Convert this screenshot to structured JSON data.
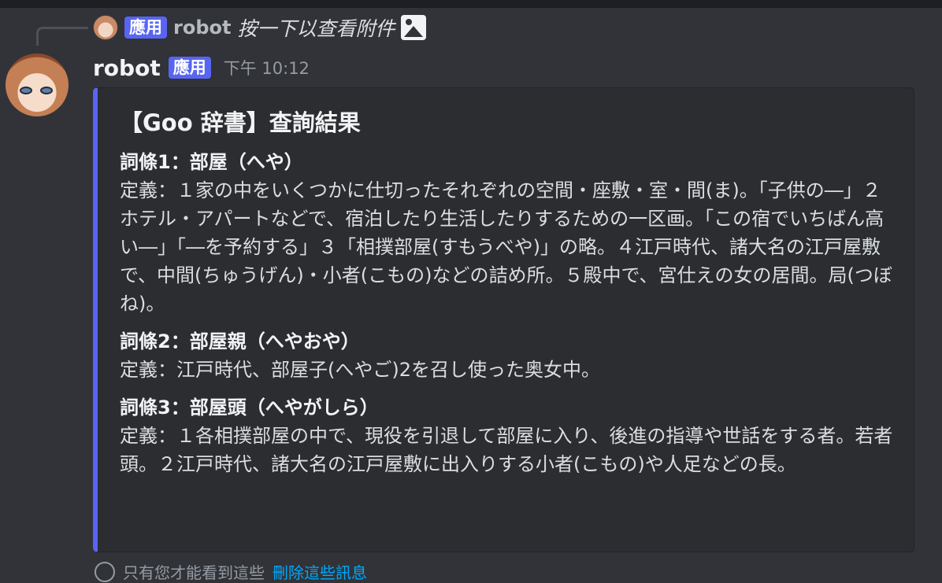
{
  "reply": {
    "app_tag": "應用",
    "author": "robot",
    "text": "按一下以查看附件",
    "attachment_icon": "image-icon"
  },
  "message": {
    "author": "robot",
    "app_tag": "應用",
    "timestamp": "下午 10:12"
  },
  "embed": {
    "accent_color": "#5865f2",
    "title": "【Goo 辞書】查詢結果",
    "entries": [
      {
        "heading": "詞條1：部屋（へや）",
        "definition": "定義：１家の中をいくつかに仕切ったそれぞれの空間・座敷・室・間(ま)。「子供の―」２ホテル・アパートなどで、宿泊したり生活したりするための一区画。「この宿でいちばん高い―」「―を予約する」３「相撲部屋(すもうべや)」の略。４江戸時代、諸大名の江戸屋敷で、中間(ちゅうげん)・小者(こもの)などの詰め所。５殿中で、宮仕えの女の居間。局(つぼね)。"
      },
      {
        "heading": "詞條2：部屋親（へやおや）",
        "definition": "定義：江戸時代、部屋子(へやご)2を召し使った奥女中。"
      },
      {
        "heading": "詞條3：部屋頭（へやがしら）",
        "definition": "定義：１各相撲部屋の中で、現役を引退して部屋に入り、後進の指導や世話をする者。若者頭。２江戸時代、諸大名の江戸屋敷に出入りする小者(こもの)や人足などの長。"
      }
    ]
  },
  "footer": {
    "text": "只有您才能看到這些",
    "link": "刪除這些訊息"
  }
}
